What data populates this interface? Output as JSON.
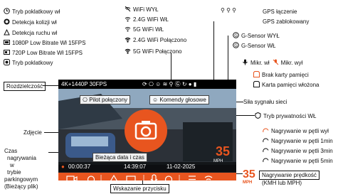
{
  "left_icons_list": [
    "Tryb poklatkowy wł",
    "Detekcja kolizji wł",
    "Detekcja ruchu wł",
    "1080P Low Bitrate Wł 15FPS",
    "720P Low Bitrate Wł 15FPS",
    "Tryb poklatkowy"
  ],
  "wifi_list": [
    "WiFi WYŁ",
    "2.4G WiFi WŁ",
    "5G WiFi WŁ",
    "2.4G WiFi Połączono",
    "5G WiFi Połączono"
  ],
  "gps": {
    "on": "GPS łączenie",
    "locked": "GPS zablokowany"
  },
  "gsensor": {
    "off": "G-Sensor WYŁ",
    "on": "G-Sensor WŁ"
  },
  "mic": {
    "on": "Mikr. wł",
    "off": "Mikr. wył"
  },
  "card": {
    "none": "Brak karty pamięci",
    "inserted": "Karta pamięci włożona"
  },
  "signal": "Siła sygnału sieci",
  "privacy": "Tryb prywatności WŁ",
  "loop": [
    "Nagrywanie w pętli wył",
    "Nagrywanie w pętli 1min",
    "Nagrywanie w pętli 3min",
    "Nagrywanie w pętli 5min"
  ],
  "speed": {
    "label_line1": "Nagrywanie prędkość",
    "label_line2": "(KMH lub MPH)",
    "value": "35",
    "unit": "MPH",
    "unit_small": "MPH"
  },
  "resolution_label": "Rozdzielczość",
  "resolution_value": "4K+1440P 30FPS",
  "pilot": "Pilot połączony",
  "voice": "Komendy głosowe",
  "photo": "Zdjęcie",
  "datetime_label": "Bieżąca data i czas",
  "time_left_label": "Czas nagrywania w trybie parkingowym (Bieżący plik)",
  "time_left_lines": [
    "Czas",
    "nagrywania",
    "w",
    "trybie",
    "parkingowym",
    "(Bieżący plik)"
  ],
  "status": {
    "rec_time": "00:00:37",
    "clock": "14:39:07",
    "date": "11-02-2025"
  },
  "buttons_label": "Wskazanie przycisku",
  "accent": "#e8551f"
}
